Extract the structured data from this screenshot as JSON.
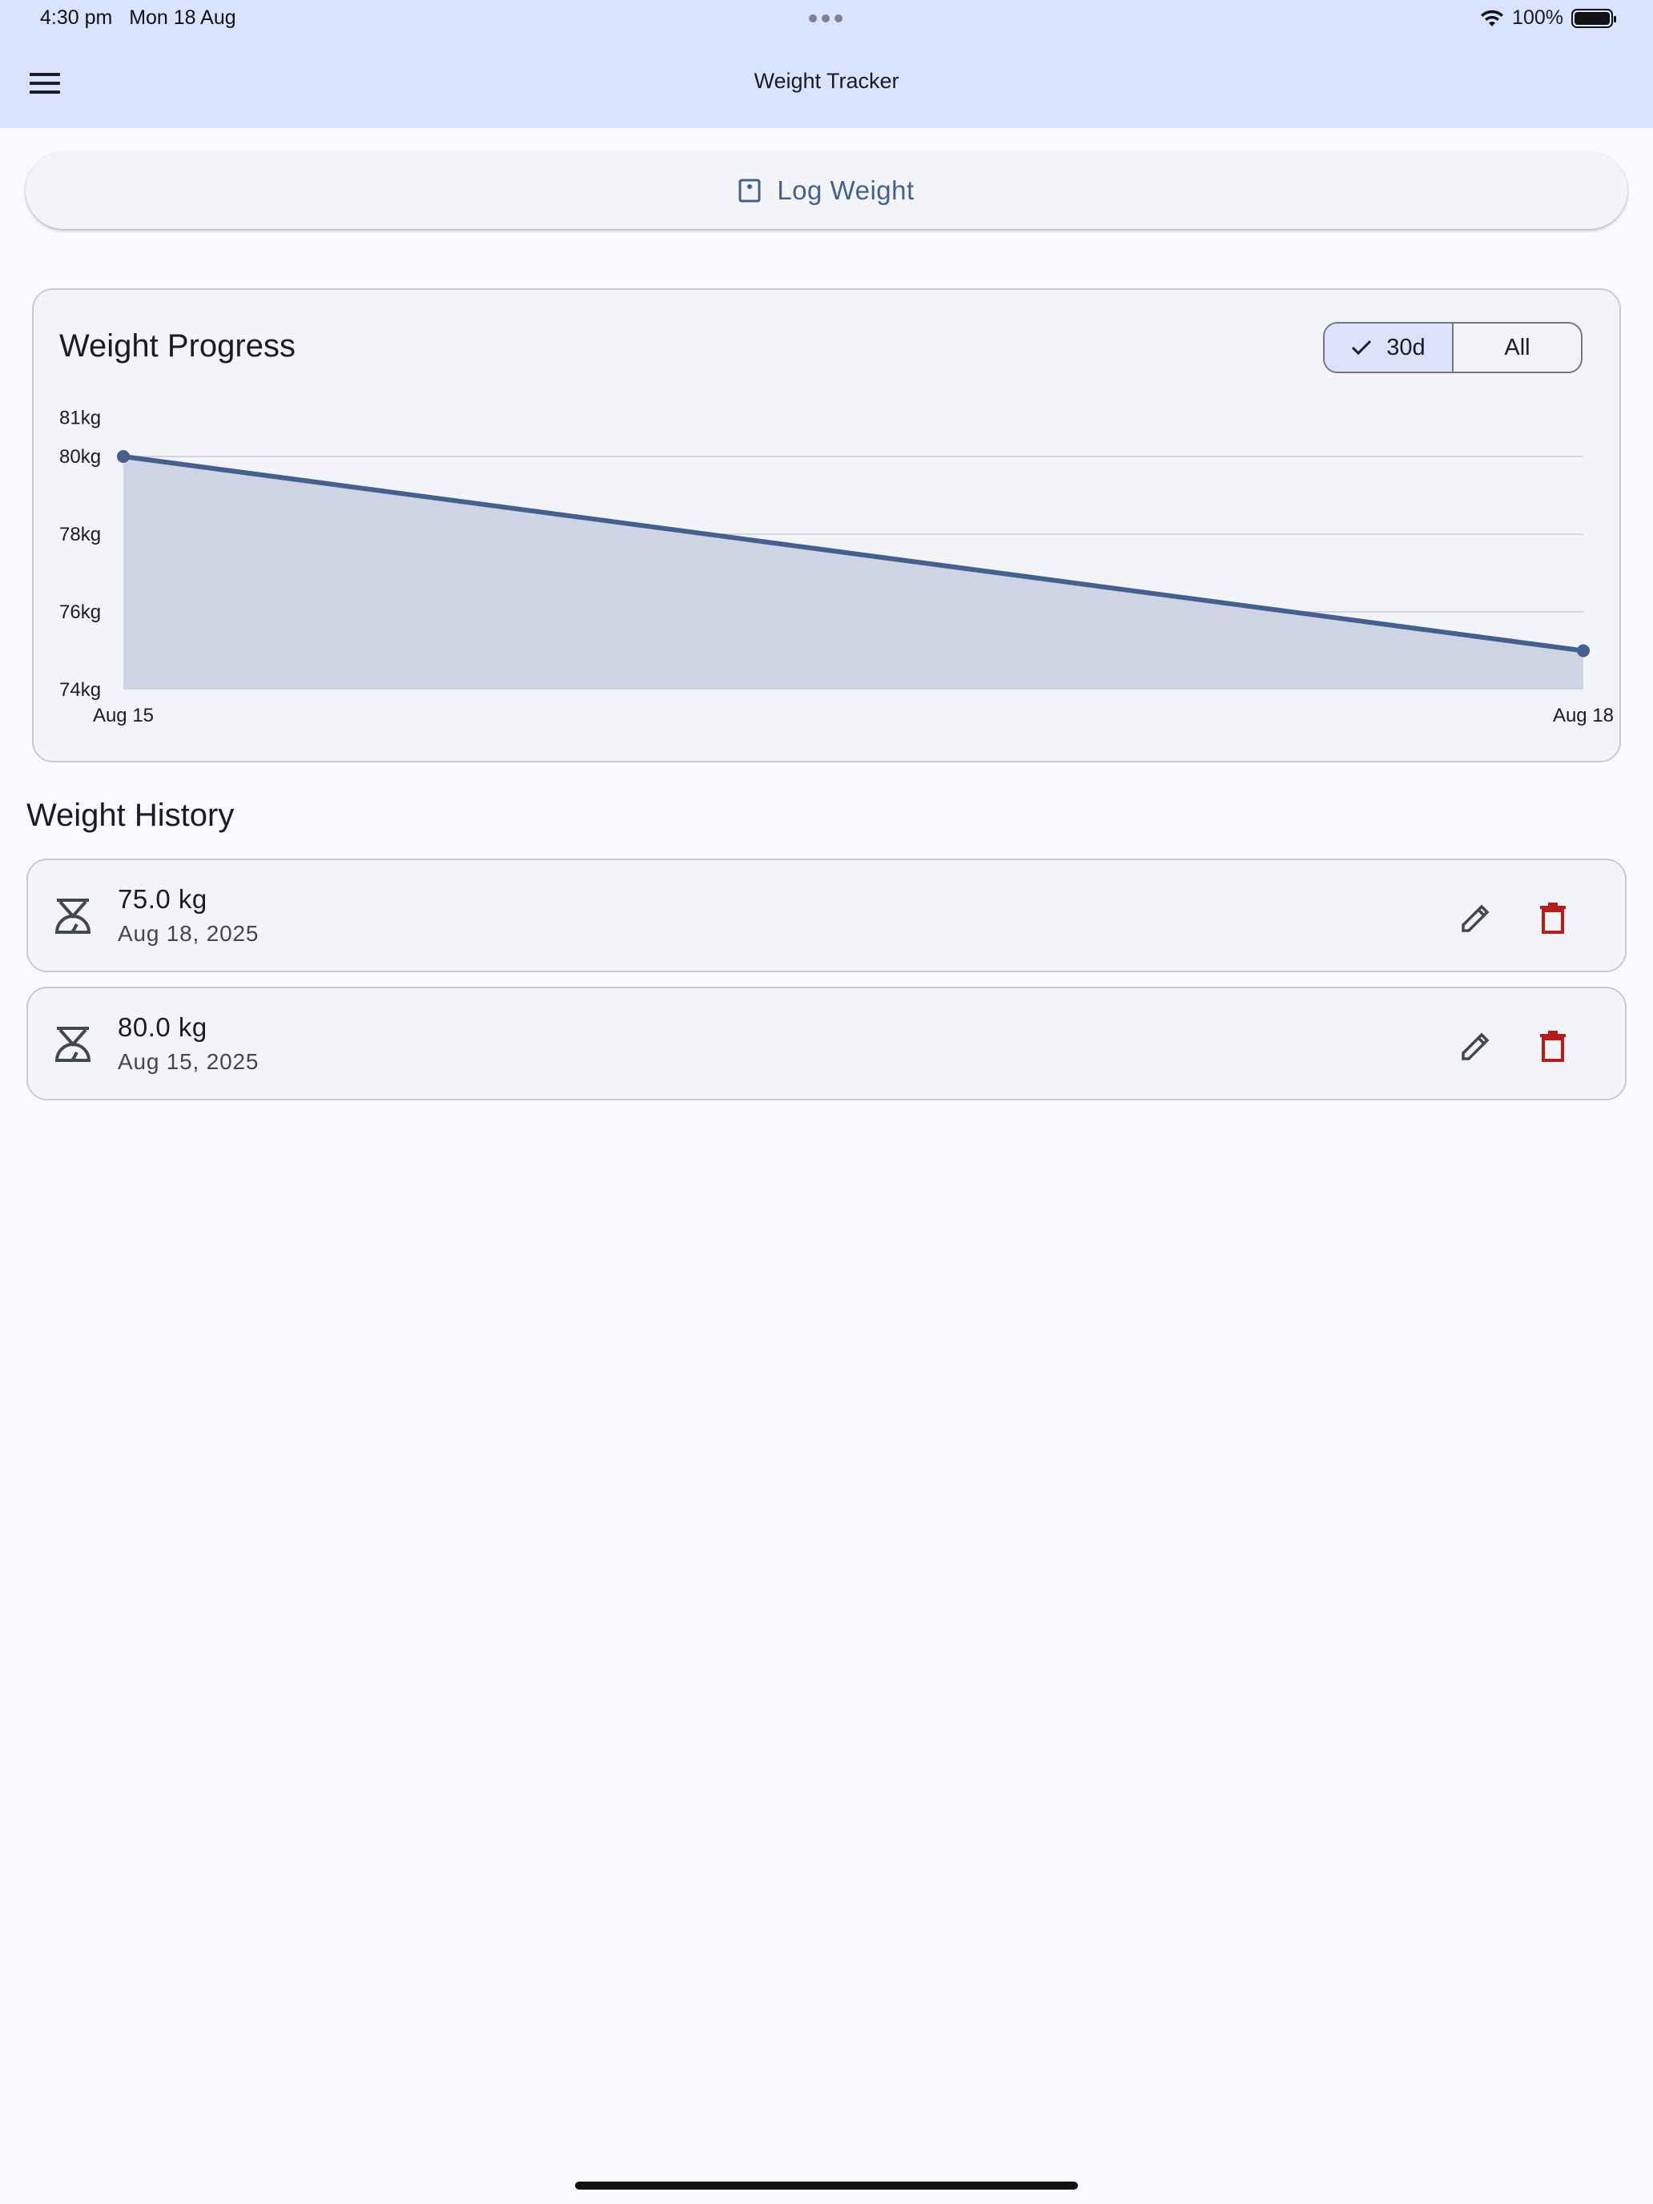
{
  "status_bar": {
    "time": "4:30 pm",
    "date": "Mon 18 Aug",
    "battery": "100%"
  },
  "app_bar": {
    "title": "Weight Tracker",
    "menu_icon": "hamburger-menu-icon"
  },
  "log_button": {
    "label": "Log Weight",
    "icon": "scale-square-icon"
  },
  "progress_card": {
    "title": "Weight Progress",
    "range_options": [
      {
        "label": "30d",
        "selected": true
      },
      {
        "label": "All",
        "selected": false
      }
    ]
  },
  "chart_data": {
    "type": "area",
    "x": [
      "Aug 15",
      "Aug 18"
    ],
    "values": [
      80,
      75
    ],
    "ylim": [
      74,
      81
    ],
    "yticks": [
      "81kg",
      "80kg",
      "78kg",
      "76kg",
      "74kg"
    ],
    "xticks": [
      "Aug 15",
      "Aug 18"
    ],
    "grid": true,
    "line_color": "#44608f",
    "fill_color": "#ced4e3"
  },
  "history": {
    "title": "Weight History",
    "entries": [
      {
        "weight": "75.0 kg",
        "date": "Aug 18, 2025"
      },
      {
        "weight": "80.0 kg",
        "date": "Aug 15, 2025"
      }
    ]
  },
  "colors": {
    "accent": "#44608f",
    "delete": "#ba1a1a",
    "appbar_bg": "#d9e2fe"
  }
}
